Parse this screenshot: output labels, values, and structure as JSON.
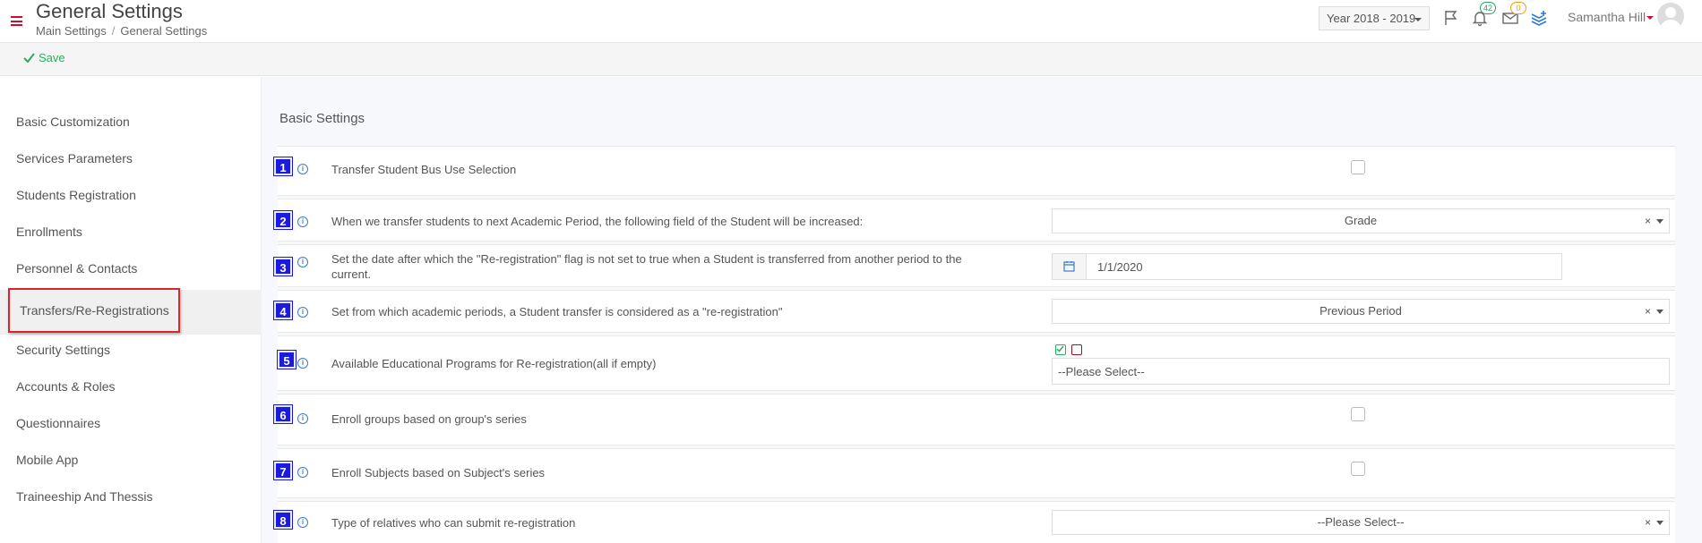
{
  "header": {
    "title": "General Settings",
    "breadcrumb": [
      "Main Settings",
      "General Settings"
    ],
    "year_select": "Year 2018 - 2019",
    "notifications_count": "42",
    "messages_count": "0",
    "user_name": "Samantha Hill"
  },
  "toolbar": {
    "save_label": "Save"
  },
  "sidebar": {
    "items": [
      "Basic Customization",
      "Services Parameters",
      "Students Registration",
      "Enrollments",
      "Personnel & Contacts",
      "Transfers/Re-Registrations",
      "Security Settings",
      "Accounts & Roles",
      "Questionnaires",
      "Mobile App",
      "Traineeship And Thessis"
    ],
    "active_index": 5
  },
  "main": {
    "section_title": "Basic Settings",
    "info_glyph": "i",
    "settings": [
      {
        "num": "1",
        "label": "Transfer Student Bus Use Selection",
        "control": "checkbox"
      },
      {
        "num": "2",
        "label": "When we transfer students to next Academic Period, the following field of the Student will be increased:",
        "control": "select",
        "value": "Grade",
        "clear": "×"
      },
      {
        "num": "3",
        "label": "Set the date after which the \"Re-registration\" flag is not set to true when a Student is transferred from another period to the current.",
        "control": "date",
        "value": "1/1/2020"
      },
      {
        "num": "4",
        "label": "Set from which academic periods, a Student transfer is considered as a \"re-registration\"",
        "control": "select",
        "value": "Previous Period",
        "clear": "×"
      },
      {
        "num": "5",
        "label": "Available Educational Programs for Re-registration(all if empty)",
        "control": "multiselect",
        "placeholder": "--Please Select--"
      },
      {
        "num": "6",
        "label": "Enroll groups based on group's series",
        "control": "checkbox"
      },
      {
        "num": "7",
        "label": "Enroll Subjects based on Subject's series",
        "control": "checkbox"
      },
      {
        "num": "8",
        "label": "Type of relatives who can submit re-registration",
        "control": "select",
        "value": "--Please Select--",
        "clear": "×"
      }
    ]
  },
  "colors": {
    "accent_red": "#c8102e",
    "save_green": "#27ae60",
    "number_blue": "#1a1ae0",
    "highlight_border": "#d9262c"
  }
}
